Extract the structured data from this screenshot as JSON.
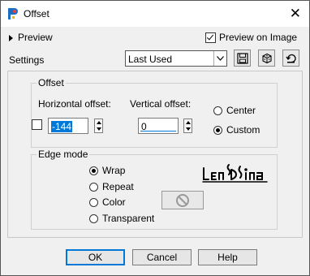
{
  "window": {
    "title": "Offset",
    "close_glyph": "✕"
  },
  "preview": {
    "toggle_label": "Preview",
    "preview_on_image_label": "Preview on Image",
    "preview_on_image_checked": true
  },
  "settings": {
    "label": "Settings",
    "selected": "Last Used"
  },
  "offset": {
    "group_label": "Offset",
    "horizontal_label": "Horizontal offset:",
    "horizontal_value": "-144",
    "vertical_label": "Vertical offset:",
    "vertical_value": "0",
    "options": [
      {
        "label": "Center",
        "selected": false
      },
      {
        "label": "Custom",
        "selected": true
      }
    ]
  },
  "edge_mode": {
    "group_label": "Edge mode",
    "options": [
      {
        "label": "Wrap",
        "selected": true
      },
      {
        "label": "Repeat",
        "selected": false
      },
      {
        "label": "Color",
        "selected": false
      },
      {
        "label": "Transparent",
        "selected": false
      }
    ]
  },
  "buttons": {
    "ok": "OK",
    "cancel": "Cancel",
    "help": "Help"
  },
  "colors": {
    "accent": "#0078d7",
    "window_bg": "#f0f0f0"
  }
}
